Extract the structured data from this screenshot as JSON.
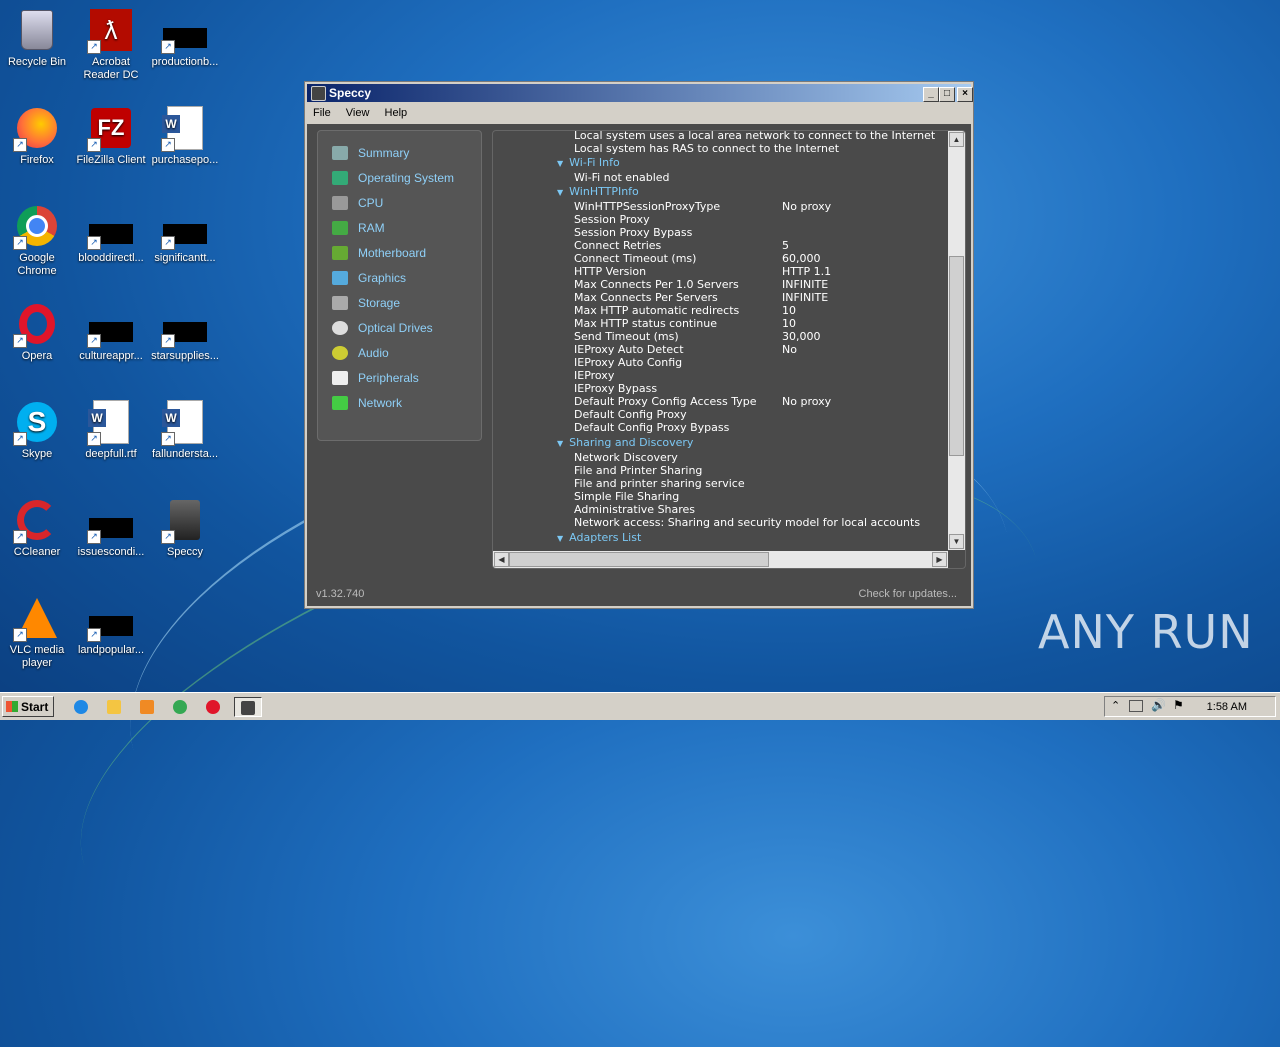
{
  "desktop": {
    "icons": [
      {
        "label": "Recycle Bin",
        "icon": "recycle-bin-icon"
      },
      {
        "label": "Acrobat Reader DC",
        "icon": "acrobat-icon"
      },
      {
        "label": "productionb...",
        "icon": "file-icon"
      },
      {
        "label": "Firefox",
        "icon": "firefox-icon"
      },
      {
        "label": "FileZilla Client",
        "icon": "filezilla-icon"
      },
      {
        "label": "purchasepo...",
        "icon": "word-doc-icon"
      },
      {
        "label": "Google Chrome",
        "icon": "chrome-icon"
      },
      {
        "label": "blooddirectl...",
        "icon": "file-icon"
      },
      {
        "label": "significantt...",
        "icon": "file-icon"
      },
      {
        "label": "Opera",
        "icon": "opera-icon"
      },
      {
        "label": "cultureappr...",
        "icon": "file-icon"
      },
      {
        "label": "starsupplies...",
        "icon": "file-icon"
      },
      {
        "label": "Skype",
        "icon": "skype-icon"
      },
      {
        "label": "deepfull.rtf",
        "icon": "word-doc-icon"
      },
      {
        "label": "fallundersta...",
        "icon": "word-doc-icon"
      },
      {
        "label": "CCleaner",
        "icon": "ccleaner-icon"
      },
      {
        "label": "issuescondi...",
        "icon": "file-icon"
      },
      {
        "label": "Speccy",
        "icon": "speccy-icon"
      },
      {
        "label": "VLC media player",
        "icon": "vlc-icon"
      },
      {
        "label": "landpopular...",
        "icon": "file-icon"
      }
    ]
  },
  "window": {
    "title": "Speccy",
    "menu": [
      "File",
      "View",
      "Help"
    ],
    "nav": [
      {
        "label": "Summary",
        "icon": "summary-icon"
      },
      {
        "label": "Operating System",
        "icon": "windows-icon"
      },
      {
        "label": "CPU",
        "icon": "cpu-icon"
      },
      {
        "label": "RAM",
        "icon": "ram-icon"
      },
      {
        "label": "Motherboard",
        "icon": "motherboard-icon"
      },
      {
        "label": "Graphics",
        "icon": "monitor-icon"
      },
      {
        "label": "Storage",
        "icon": "storage-icon"
      },
      {
        "label": "Optical Drives",
        "icon": "disc-icon"
      },
      {
        "label": "Audio",
        "icon": "speaker-icon"
      },
      {
        "label": "Peripherals",
        "icon": "mouse-icon"
      },
      {
        "label": "Network",
        "icon": "network-icon"
      }
    ],
    "tree": [
      {
        "type": "text",
        "text": "Local system uses a local area network to connect to the Internet"
      },
      {
        "type": "text",
        "text": "Local system has RAS to connect to the Internet"
      },
      {
        "type": "section",
        "text": "Wi-Fi Info"
      },
      {
        "type": "text",
        "text": "Wi-Fi not enabled"
      },
      {
        "type": "section",
        "text": "WinHTTPInfo"
      },
      {
        "type": "kv",
        "key": "WinHTTPSessionProxyType",
        "value": "No proxy"
      },
      {
        "type": "kv",
        "key": "Session Proxy",
        "value": ""
      },
      {
        "type": "kv",
        "key": "Session Proxy Bypass",
        "value": ""
      },
      {
        "type": "kv",
        "key": "Connect Retries",
        "value": "5"
      },
      {
        "type": "kv",
        "key": "Connect Timeout (ms)",
        "value": "60,000"
      },
      {
        "type": "kv",
        "key": "HTTP Version",
        "value": "HTTP 1.1"
      },
      {
        "type": "kv",
        "key": "Max Connects Per 1.0 Servers",
        "value": "INFINITE"
      },
      {
        "type": "kv",
        "key": "Max Connects Per Servers",
        "value": "INFINITE"
      },
      {
        "type": "kv",
        "key": "Max HTTP automatic redirects",
        "value": "10"
      },
      {
        "type": "kv",
        "key": "Max HTTP status continue",
        "value": "10"
      },
      {
        "type": "kv",
        "key": "Send Timeout (ms)",
        "value": "30,000"
      },
      {
        "type": "kv",
        "key": "IEProxy Auto Detect",
        "value": "No"
      },
      {
        "type": "kv",
        "key": "IEProxy Auto Config",
        "value": ""
      },
      {
        "type": "kv",
        "key": "IEProxy",
        "value": ""
      },
      {
        "type": "kv",
        "key": "IEProxy Bypass",
        "value": ""
      },
      {
        "type": "kv",
        "key": "Default Proxy Config Access Type",
        "value": "No proxy"
      },
      {
        "type": "kv",
        "key": "Default Config Proxy",
        "value": ""
      },
      {
        "type": "kv",
        "key": "Default Config Proxy Bypass",
        "value": ""
      },
      {
        "type": "section",
        "text": "Sharing and Discovery"
      },
      {
        "type": "text",
        "text": "Network Discovery"
      },
      {
        "type": "text",
        "text": "File and Printer Sharing"
      },
      {
        "type": "text",
        "text": "File and printer sharing service"
      },
      {
        "type": "text",
        "text": "Simple File Sharing"
      },
      {
        "type": "text",
        "text": "Administrative Shares"
      },
      {
        "type": "text",
        "text": "Network access: Sharing and security model for local accounts"
      },
      {
        "type": "section",
        "text": "Adapters List"
      }
    ],
    "version": "v1.32.740",
    "check_updates": "Check for updates..."
  },
  "taskbar": {
    "start_label": "Start",
    "apps": [
      "ie-icon",
      "explorer-icon",
      "media-player-icon",
      "chrome-icon",
      "opera-icon",
      "speccy-icon"
    ],
    "clock": "1:58 AM"
  },
  "watermark": "ANY RUN"
}
